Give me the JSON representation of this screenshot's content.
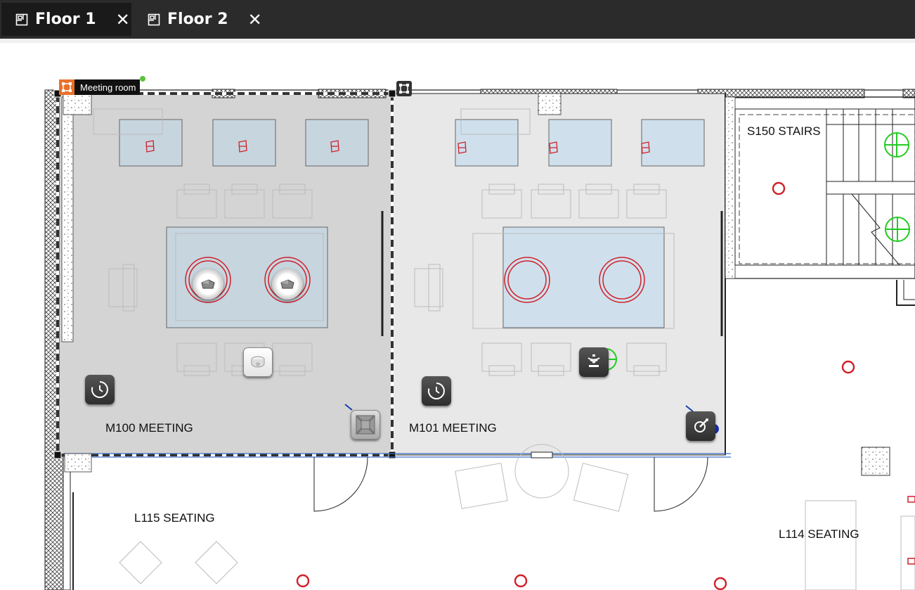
{
  "tabs": [
    {
      "label": "Floor 1",
      "active": true,
      "icon": "floorplan-icon",
      "close": "✕"
    },
    {
      "label": "Floor 2",
      "active": false,
      "icon": "floorplan-icon",
      "close": "✕"
    }
  ],
  "room_tag": {
    "label": "Meeting room",
    "icon": "room-select-icon"
  },
  "rooms": {
    "m100": "M100 MEETING",
    "m101": "M101 MEETING",
    "s150": "S150 STAIRS",
    "l115": "L115 SEATING",
    "l114": "L114 SEATING"
  },
  "devices": [
    {
      "name": "schedule-clock-device",
      "icon": "clock-icon"
    },
    {
      "name": "schedule-clock-device",
      "icon": "clock-icon"
    },
    {
      "name": "ceiling-light-device",
      "icon": "ceiling-light-icon"
    },
    {
      "name": "wireless-sensor-device",
      "icon": "signal-icon"
    },
    {
      "name": "vent-device",
      "icon": "vent-icon"
    },
    {
      "name": "thermostat-device",
      "icon": "gauge-icon"
    },
    {
      "name": "ceiling-speaker-device",
      "icon": "speaker-icon"
    },
    {
      "name": "ceiling-speaker-device",
      "icon": "speaker-icon"
    }
  ],
  "colors": {
    "accent": "#e8712a",
    "marker": "#d0202a",
    "sprinkler": "#22cc22",
    "status": "#5cc13a"
  }
}
